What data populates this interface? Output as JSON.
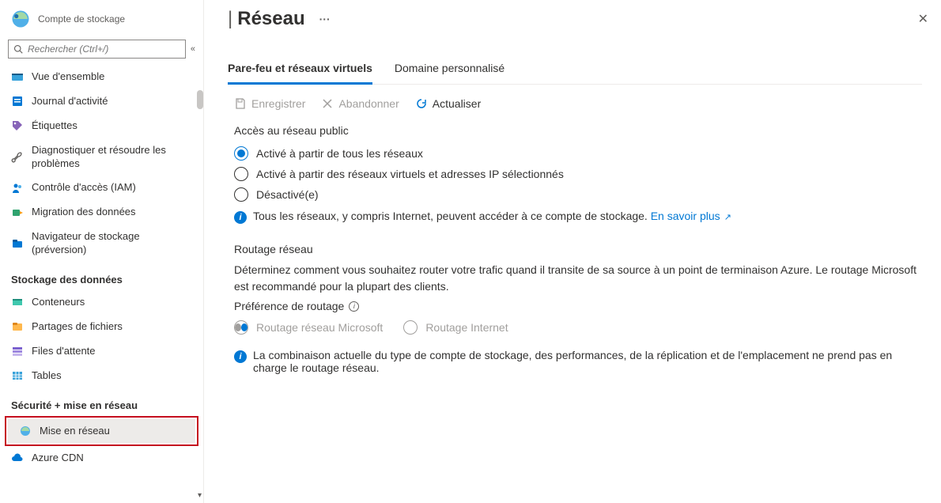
{
  "sidebar": {
    "subtitle": "Compte de stockage",
    "search_placeholder": "Rechercher (Ctrl+/)",
    "items_top": [
      {
        "label": "Vue d'ensemble"
      },
      {
        "label": "Journal d'activité"
      },
      {
        "label": "Étiquettes"
      },
      {
        "label": "Diagnostiquer et résoudre les problèmes"
      },
      {
        "label": "Contrôle d'accès (IAM)"
      },
      {
        "label": "Migration des données"
      },
      {
        "label": "Navigateur de stockage (préversion)"
      }
    ],
    "section_storage": "Stockage des données",
    "items_storage": [
      {
        "label": "Conteneurs"
      },
      {
        "label": "Partages de fichiers"
      },
      {
        "label": "Files d'attente"
      },
      {
        "label": "Tables"
      }
    ],
    "section_security": "Sécurité + mise en réseau",
    "items_security": [
      {
        "label": "Mise en réseau"
      },
      {
        "label": "Azure CDN"
      }
    ]
  },
  "page": {
    "title": "Réseau",
    "tabs": [
      {
        "label": "Pare-feu et réseaux virtuels",
        "active": true
      },
      {
        "label": "Domaine personnalisé",
        "active": false
      }
    ],
    "toolbar": {
      "save": "Enregistrer",
      "discard": "Abandonner",
      "refresh": "Actualiser"
    },
    "public_access": {
      "heading": "Accès au réseau public",
      "options": [
        {
          "label": "Activé à partir de tous les réseaux",
          "checked": true
        },
        {
          "label": "Activé à partir des réseaux virtuels et adresses IP sélectionnés",
          "checked": false
        },
        {
          "label": "Désactivé(e)",
          "checked": false
        }
      ],
      "info_text": "Tous les réseaux, y compris Internet, peuvent accéder à ce compte de stockage.",
      "info_link": "En savoir plus"
    },
    "routing": {
      "heading": "Routage réseau",
      "desc": "Déterminez comment vous souhaitez router votre trafic quand il transite de sa source à un point de terminaison Azure. Le routage Microsoft est recommandé pour la plupart des clients.",
      "pref_label": "Préférence de routage",
      "options": [
        {
          "label": "Routage réseau Microsoft"
        },
        {
          "label": "Routage Internet"
        }
      ],
      "warning": "La combinaison actuelle du type de compte de stockage, des performances, de la réplication et de l'emplacement ne prend pas en charge le routage réseau."
    }
  }
}
